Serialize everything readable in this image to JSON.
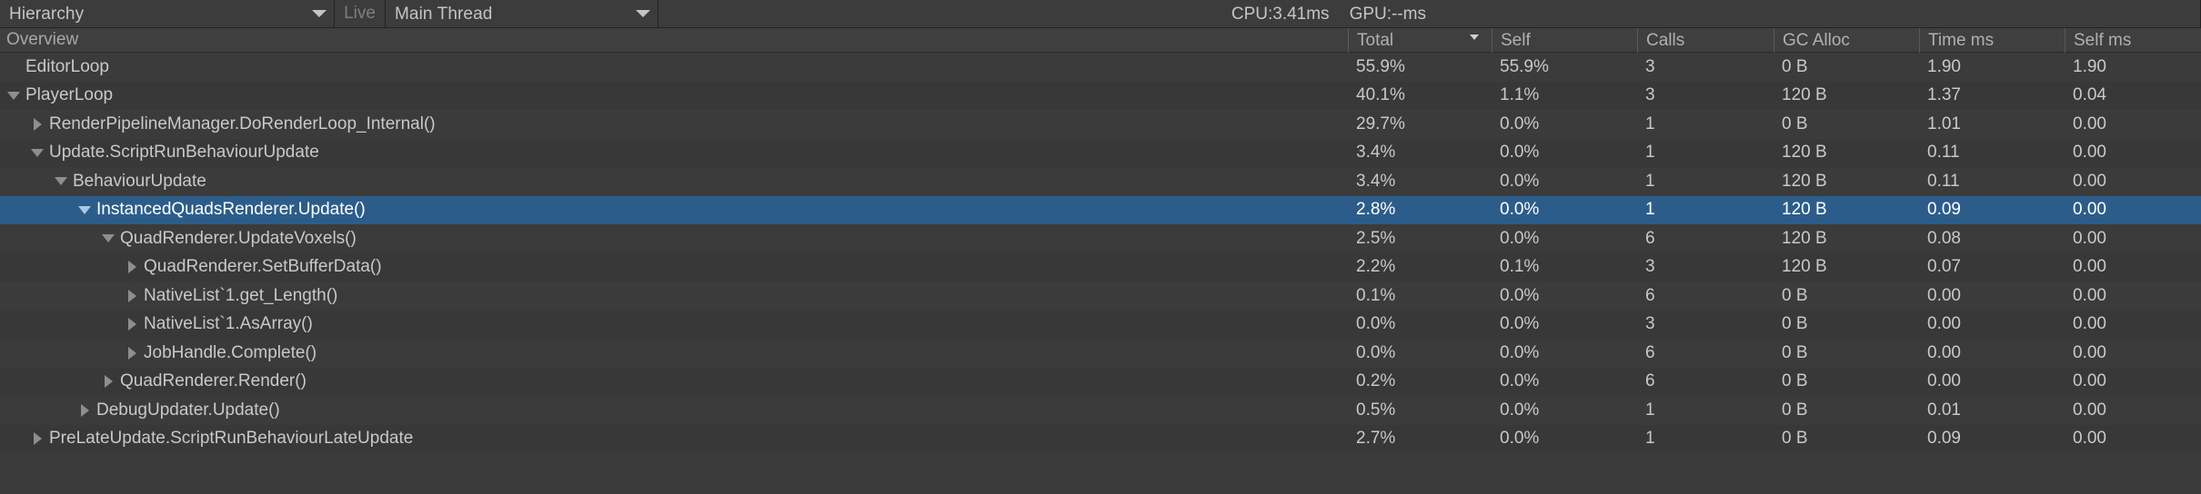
{
  "toolbar": {
    "view_mode": "Hierarchy",
    "live_label": "Live",
    "thread": "Main Thread",
    "cpu_stat": "CPU:3.41ms",
    "gpu_stat": "GPU:--ms"
  },
  "colors": {
    "background": "#3b3b3b",
    "row_alt": "#383838",
    "toolbar": "#3c3c3c",
    "header": "#3f3f3f",
    "selection": "#2c5d8a",
    "text": "#c9c9c9",
    "text_dim": "#7e7e7e",
    "separator": "#232323",
    "twisty": "#8e8e8e"
  },
  "table": {
    "name_column_header": "Overview",
    "columns": [
      {
        "label": "Total",
        "sorted": true
      },
      {
        "label": "Self",
        "sorted": false
      },
      {
        "label": "Calls",
        "sorted": false
      },
      {
        "label": "GC Alloc",
        "sorted": false
      },
      {
        "label": "Time ms",
        "sorted": false
      },
      {
        "label": "Self ms",
        "sorted": false
      }
    ],
    "rows": [
      {
        "name": "EditorLoop",
        "depth": 1,
        "twisty": "none",
        "selected": false,
        "total": "55.9%",
        "self": "55.9%",
        "calls": "3",
        "gc_alloc": "0 B",
        "time_ms": "1.90",
        "self_ms": "1.90"
      },
      {
        "name": "PlayerLoop",
        "depth": 1,
        "twisty": "expanded",
        "selected": false,
        "total": "40.1%",
        "self": "1.1%",
        "calls": "3",
        "gc_alloc": "120 B",
        "time_ms": "1.37",
        "self_ms": "0.04"
      },
      {
        "name": "RenderPipelineManager.DoRenderLoop_Internal()",
        "depth": 2,
        "twisty": "collapsed",
        "selected": false,
        "total": "29.7%",
        "self": "0.0%",
        "calls": "1",
        "gc_alloc": "0 B",
        "time_ms": "1.01",
        "self_ms": "0.00"
      },
      {
        "name": "Update.ScriptRunBehaviourUpdate",
        "depth": 2,
        "twisty": "expanded",
        "selected": false,
        "total": "3.4%",
        "self": "0.0%",
        "calls": "1",
        "gc_alloc": "120 B",
        "time_ms": "0.11",
        "self_ms": "0.00"
      },
      {
        "name": "BehaviourUpdate",
        "depth": 3,
        "twisty": "expanded",
        "selected": false,
        "total": "3.4%",
        "self": "0.0%",
        "calls": "1",
        "gc_alloc": "120 B",
        "time_ms": "0.11",
        "self_ms": "0.00"
      },
      {
        "name": "InstancedQuadsRenderer.Update()",
        "depth": 4,
        "twisty": "expanded",
        "selected": true,
        "total": "2.8%",
        "self": "0.0%",
        "calls": "1",
        "gc_alloc": "120 B",
        "time_ms": "0.09",
        "self_ms": "0.00"
      },
      {
        "name": "QuadRenderer.UpdateVoxels()",
        "depth": 5,
        "twisty": "expanded",
        "selected": false,
        "total": "2.5%",
        "self": "0.0%",
        "calls": "6",
        "gc_alloc": "120 B",
        "time_ms": "0.08",
        "self_ms": "0.00"
      },
      {
        "name": "QuadRenderer.SetBufferData()",
        "depth": 6,
        "twisty": "collapsed",
        "selected": false,
        "total": "2.2%",
        "self": "0.1%",
        "calls": "3",
        "gc_alloc": "120 B",
        "time_ms": "0.07",
        "self_ms": "0.00"
      },
      {
        "name": "NativeList`1.get_Length()",
        "depth": 6,
        "twisty": "collapsed",
        "selected": false,
        "total": "0.1%",
        "self": "0.0%",
        "calls": "6",
        "gc_alloc": "0 B",
        "time_ms": "0.00",
        "self_ms": "0.00"
      },
      {
        "name": "NativeList`1.AsArray()",
        "depth": 6,
        "twisty": "collapsed",
        "selected": false,
        "total": "0.0%",
        "self": "0.0%",
        "calls": "3",
        "gc_alloc": "0 B",
        "time_ms": "0.00",
        "self_ms": "0.00"
      },
      {
        "name": "JobHandle.Complete()",
        "depth": 6,
        "twisty": "collapsed",
        "selected": false,
        "total": "0.0%",
        "self": "0.0%",
        "calls": "6",
        "gc_alloc": "0 B",
        "time_ms": "0.00",
        "self_ms": "0.00"
      },
      {
        "name": "QuadRenderer.Render()",
        "depth": 5,
        "twisty": "collapsed",
        "selected": false,
        "total": "0.2%",
        "self": "0.0%",
        "calls": "6",
        "gc_alloc": "0 B",
        "time_ms": "0.00",
        "self_ms": "0.00"
      },
      {
        "name": "DebugUpdater.Update()",
        "depth": 4,
        "twisty": "collapsed",
        "selected": false,
        "total": "0.5%",
        "self": "0.0%",
        "calls": "1",
        "gc_alloc": "0 B",
        "time_ms": "0.01",
        "self_ms": "0.00"
      },
      {
        "name": "PreLateUpdate.ScriptRunBehaviourLateUpdate",
        "depth": 2,
        "twisty": "collapsed",
        "selected": false,
        "total": "2.7%",
        "self": "0.0%",
        "calls": "1",
        "gc_alloc": "0 B",
        "time_ms": "0.09",
        "self_ms": "0.00"
      }
    ]
  }
}
